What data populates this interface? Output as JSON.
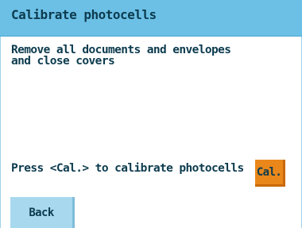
{
  "header": {
    "title": "Calibrate photocells"
  },
  "instruction": {
    "lines": [
      "Remove all documents and envelopes",
      "and close covers"
    ]
  },
  "prompt": {
    "text": "Press <Cal.> to calibrate photocells"
  },
  "buttons": {
    "cal_label": "Cal.",
    "back_label": "Back"
  },
  "colors": {
    "header_bg": "#6cc0e6",
    "text": "#0c3b4e",
    "cal_button": "#e9871b",
    "back_button": "#a8d8ee"
  }
}
